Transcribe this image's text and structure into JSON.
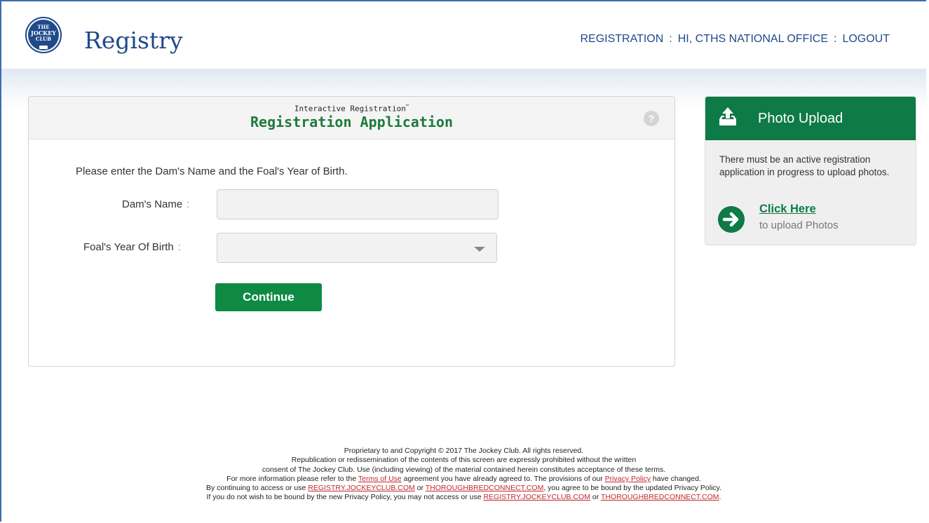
{
  "header": {
    "logo_seal": {
      "line1": "THE",
      "line2": "JOCKEY",
      "line3": "CLUB"
    },
    "logo_text": "Registry",
    "nav": {
      "registration": "REGISTRATION",
      "greeting": "HI, CTHS NATIONAL OFFICE",
      "logout": "LOGOUT",
      "separator": ":"
    }
  },
  "form": {
    "subtitle": "Interactive Registration",
    "subtitle_tm": "™",
    "title": "Registration Application",
    "help_symbol": "?",
    "instructions": "Please enter the Dam's Name and the Foal's Year of Birth.",
    "dam_name": {
      "label": "Dam's Name",
      "colon": ":",
      "value": "",
      "placeholder": ""
    },
    "foal_year": {
      "label": "Foal's Year Of Birth",
      "colon": ":",
      "selected": ""
    },
    "continue_label": "Continue"
  },
  "photo_upload": {
    "title": "Photo Upload",
    "text": "There must be an active registration application in progress to upload photos.",
    "link_label": "Click Here",
    "link_sub": "to upload Photos"
  },
  "footer": {
    "l1": "Proprietary to and Copyright © 2017 The Jockey Club. All rights reserved.",
    "l2": "Republication or redissemination of the contents of this screen are expressly prohibited without the written",
    "l3": "consent of The Jockey Club. Use (including viewing) of the material contained herein constitutes acceptance of these terms.",
    "l4_a": "For more information please refer to the ",
    "l4_link1": "Terms of Use",
    "l4_b": " agreement you have already agreed to. The provisions of our ",
    "l4_link2": "Privacy Policy",
    "l4_c": " have changed.",
    "l5_a": "By continuing to access or use ",
    "l5_link1": "REGISTRY.JOCKEYCLUB.COM",
    "l5_or": " or ",
    "l5_link2": "THOROUGHBREDCONNECT.COM",
    "l5_b": ", you agree to be bound by the updated Privacy Policy.",
    "l6_a": "If you do not wish to be bound by the new Privacy Policy, you may not access or use ",
    "l6_link1": "REGISTRY.JOCKEYCLUB.COM",
    "l6_or": " or ",
    "l6_link2": "THOROUGHBREDCONNECT.COM",
    "l6_b": "."
  },
  "colors": {
    "brand_blue": "#1f4a8a",
    "brand_green": "#0e7a46",
    "button_green": "#0e8a45",
    "link_red": "#c0282d"
  },
  "icons": {
    "help": "help-icon",
    "upload": "upload-tray-icon",
    "arrow": "arrow-right-circle-icon",
    "caret": "chevron-down-icon"
  }
}
